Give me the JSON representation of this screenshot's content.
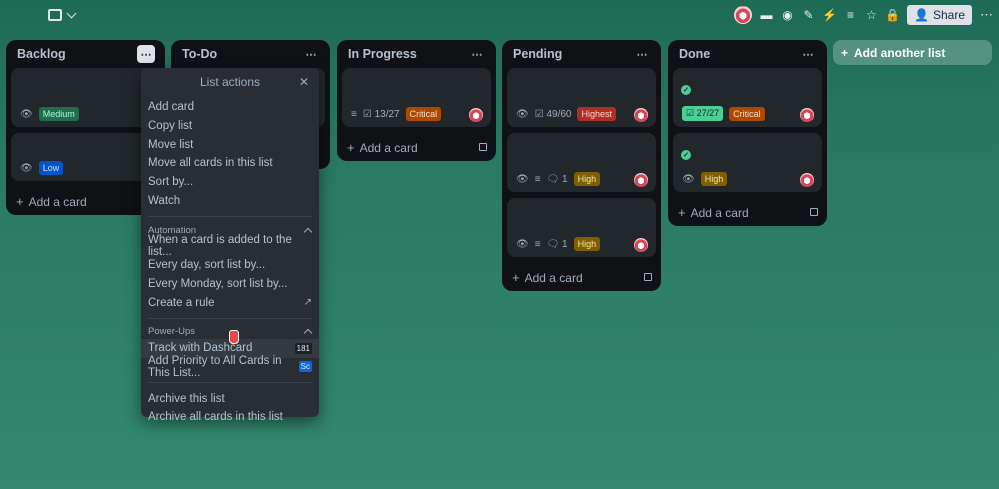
{
  "header": {
    "share_label": "Share"
  },
  "lists": [
    {
      "title": "Backlog",
      "cards": [
        {
          "label": "Medium",
          "label_kind": "medium"
        },
        {
          "label": "Low",
          "label_kind": "low"
        }
      ],
      "add_card": "Add a card"
    },
    {
      "title": "To-Do",
      "cards": [],
      "add_card": ""
    },
    {
      "title": "In Progress",
      "cards": [
        {
          "checklist": "13/27",
          "label": "Critical",
          "label_kind": "critical"
        }
      ],
      "add_card": "Add a card"
    },
    {
      "title": "Pending",
      "cards": [
        {
          "checklist": "49/60",
          "label": "Highest",
          "label_kind": "highest"
        },
        {
          "comments": "1",
          "label": "High",
          "label_kind": "high"
        },
        {
          "comments": "1",
          "label": "High",
          "label_kind": "high"
        }
      ],
      "add_card": "Add a card"
    },
    {
      "title": "Done",
      "cards": [
        {
          "checklist": "27/27",
          "label": "Critical",
          "label_kind": "critical"
        },
        {
          "label": "High",
          "label_kind": "high"
        }
      ],
      "add_card": "Add a card"
    }
  ],
  "add_list_label": "Add another list",
  "popover": {
    "title": "List actions",
    "group1": [
      "Add card",
      "Copy list",
      "Move list",
      "Move all cards in this list",
      "Sort by...",
      "Watch"
    ],
    "automation_label": "Automation",
    "automation": [
      "When a card is added to the list...",
      "Every day, sort list by...",
      "Every Monday, sort list by...",
      "Create a rule"
    ],
    "powerups_label": "Power-Ups",
    "powerups": [
      "Track with Dashcard",
      "Add Priority to All Cards in This List..."
    ],
    "powerup_badges": [
      "181",
      "Sc"
    ],
    "group3": [
      "Archive this list",
      "Archive all cards in this list"
    ]
  }
}
